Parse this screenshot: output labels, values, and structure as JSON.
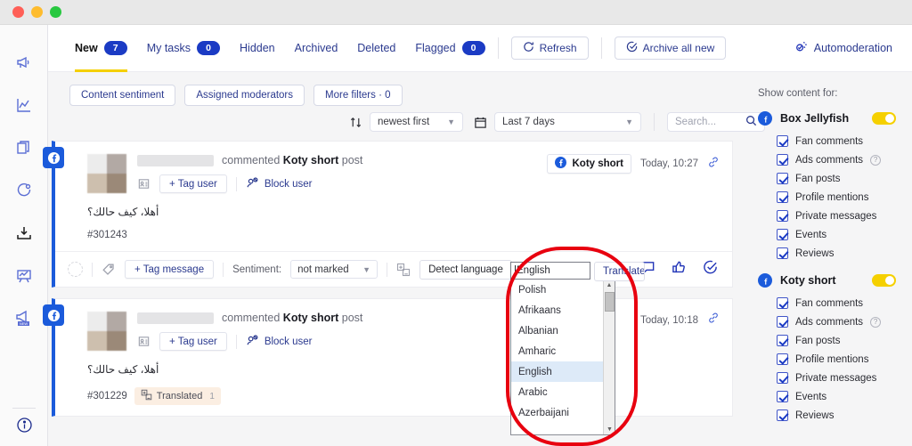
{
  "window": {
    "controls": [
      "close",
      "minimize",
      "maximize"
    ]
  },
  "rail": {
    "items": [
      {
        "name": "megaphone-icon",
        "active": false
      },
      {
        "name": "analytics-icon",
        "active": false
      },
      {
        "name": "documents-icon",
        "active": false
      },
      {
        "name": "settings-icon",
        "active": false
      },
      {
        "name": "inbox-icon",
        "active": true
      },
      {
        "name": "presentation-icon",
        "active": false
      },
      {
        "name": "announcement-icon",
        "active": false,
        "badge": "NEW"
      }
    ],
    "bottom": {
      "name": "info-icon"
    }
  },
  "topbar": {
    "tabs": [
      {
        "label": "New",
        "badge": "7",
        "active": true
      },
      {
        "label": "My tasks",
        "badge": "0",
        "active": false
      },
      {
        "label": "Hidden",
        "badge": null,
        "active": false
      },
      {
        "label": "Archived",
        "badge": null,
        "active": false
      },
      {
        "label": "Deleted",
        "badge": null,
        "active": false
      },
      {
        "label": "Flagged",
        "badge": "0",
        "active": false
      }
    ],
    "refresh_label": "Refresh",
    "archive_all_label": "Archive all new",
    "automoderation_label": "Automoderation"
  },
  "filters": [
    {
      "label": "Content sentiment"
    },
    {
      "label": "Assigned moderators"
    },
    {
      "label": "More filters · 0"
    }
  ],
  "sortrow": {
    "sort_value": "newest first",
    "date_value": "Last 7 days",
    "search_placeholder": "Search..."
  },
  "feed": {
    "cards": [
      {
        "network": "facebook",
        "action_text": "commented",
        "page_name": "Koty short",
        "action_suffix": "post",
        "tag_user_label": "+ Tag user",
        "block_user_label": "Block user",
        "message": "أهلا، كيف حالك؟",
        "message_id": "#301243",
        "source_label": "Koty short",
        "timestamp": "Today, 10:27",
        "translated": null,
        "footer": {
          "tag_message_label": "+ Tag message",
          "sentiment_label": "Sentiment:",
          "sentiment_value": "not marked",
          "detect_language_label": "Detect language"
        }
      },
      {
        "network": "facebook",
        "action_text": "commented",
        "page_name": "Koty short",
        "action_suffix": "post",
        "tag_user_label": "+ Tag user",
        "block_user_label": "Block user",
        "message": "أهلا، كيف حالك؟",
        "message_id": "#301229",
        "timestamp": "Today, 10:18",
        "translated": {
          "label": "Translated",
          "count": "1"
        }
      }
    ]
  },
  "language_dropdown": {
    "input_value": "English",
    "translate_label": "Translate",
    "options": [
      "Polish",
      "Afrikaans",
      "Albanian",
      "Amharic",
      "English",
      "Arabic",
      "Azerbaijani"
    ],
    "selected": "English",
    "annotation_color": "#e8000f"
  },
  "sidebar": {
    "title": "Show content for:",
    "groups": [
      {
        "name": "Box Jellyfish",
        "enabled": true,
        "options": [
          {
            "label": "Fan comments",
            "checked": true,
            "help": false
          },
          {
            "label": "Ads comments",
            "checked": true,
            "help": true
          },
          {
            "label": "Fan posts",
            "checked": true,
            "help": false
          },
          {
            "label": "Profile mentions",
            "checked": true,
            "help": false
          },
          {
            "label": "Private messages",
            "checked": true,
            "help": false
          },
          {
            "label": "Events",
            "checked": true,
            "help": false
          },
          {
            "label": "Reviews",
            "checked": true,
            "help": false
          }
        ]
      },
      {
        "name": "Koty short",
        "enabled": true,
        "options": [
          {
            "label": "Fan comments",
            "checked": true,
            "help": false
          },
          {
            "label": "Ads comments",
            "checked": true,
            "help": true
          },
          {
            "label": "Fan posts",
            "checked": true,
            "help": false
          },
          {
            "label": "Profile mentions",
            "checked": true,
            "help": false
          },
          {
            "label": "Private messages",
            "checked": true,
            "help": false
          },
          {
            "label": "Events",
            "checked": true,
            "help": false
          },
          {
            "label": "Reviews",
            "checked": true,
            "help": false
          }
        ]
      }
    ]
  },
  "colors": {
    "accent_blue": "#1b3bc4",
    "brand_yellow": "#f5d000",
    "fb_blue": "#1b5bdb"
  }
}
